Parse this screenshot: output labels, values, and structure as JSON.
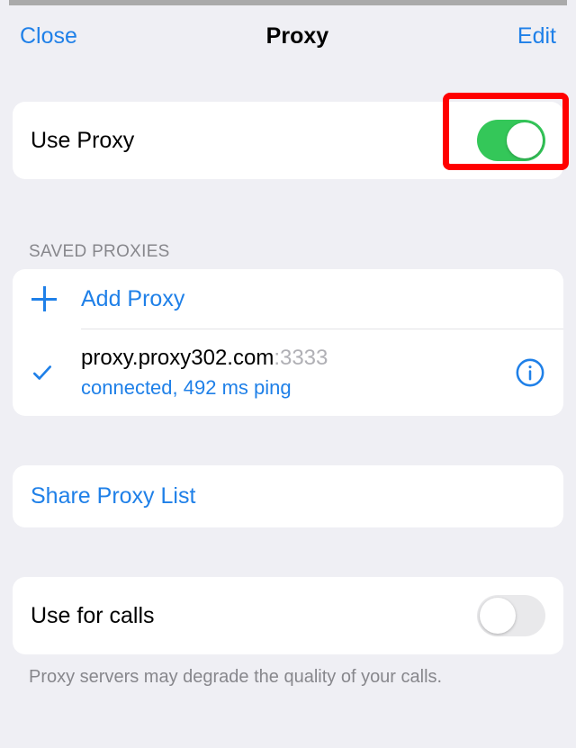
{
  "nav": {
    "close": "Close",
    "title": "Proxy",
    "edit": "Edit"
  },
  "useProxy": {
    "label": "Use Proxy",
    "on": true
  },
  "savedHeader": "SAVED PROXIES",
  "addProxy": "Add Proxy",
  "proxy": {
    "host": "proxy.proxy302.com",
    "portSuffix": ":3333",
    "status": "connected, 492 ms ping"
  },
  "share": "Share Proxy List",
  "useForCalls": {
    "label": "Use for calls",
    "on": false
  },
  "callsNote": "Proxy servers may degrade the quality of your calls."
}
